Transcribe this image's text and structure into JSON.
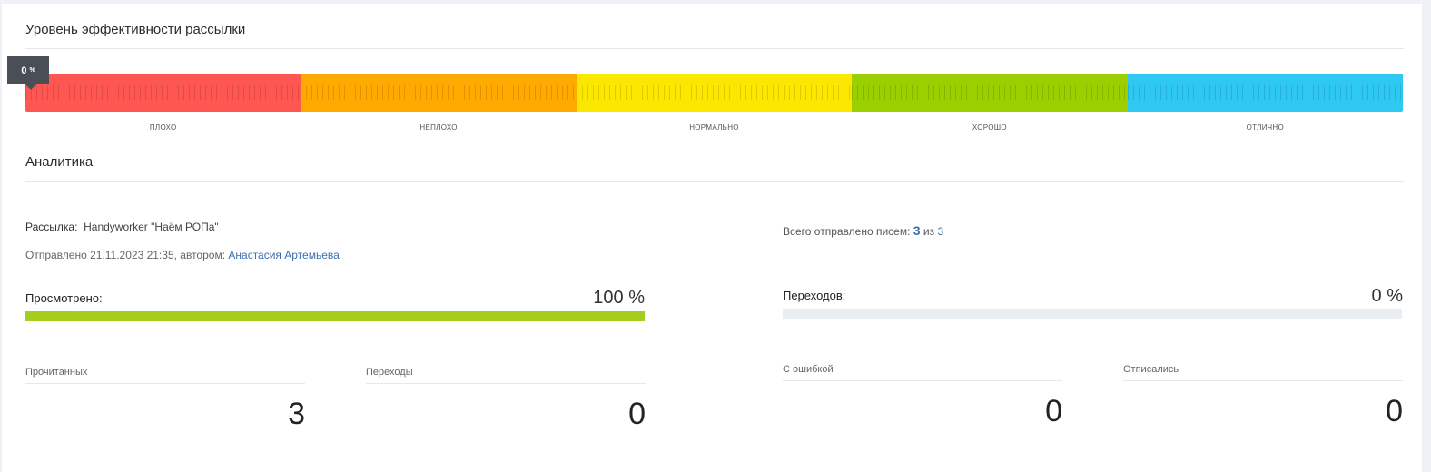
{
  "efficiency": {
    "title": "Уровень эффективности рассылки",
    "marker_value": "0",
    "marker_unit": "%",
    "level_fraction": 0,
    "levels": [
      {
        "label": "ПЛОХО",
        "color": "#fe5752"
      },
      {
        "label": "НЕПЛОХО",
        "color": "#ffaa00"
      },
      {
        "label": "НОРМАЛЬНО",
        "color": "#fbe700"
      },
      {
        "label": "ХОРОШО",
        "color": "#9bcf00"
      },
      {
        "label": "ОТЛИЧНО",
        "color": "#2fc8f3"
      }
    ]
  },
  "analytics": {
    "title": "Аналитика",
    "campaign_label": "Рассылка:",
    "campaign_name": "Handyworker \"Наём РОПа\"",
    "sent_prefix": "Отправлено 21.11.2023 21:35, автором:",
    "author": "Анастасия Артемьева",
    "total_sent_prefix": "Всего отправлено писем:",
    "total_sent": "3",
    "total_sent_of": "из",
    "total_count": "3",
    "viewed": {
      "label": "Просмотрено:",
      "value": "100 %",
      "fraction": 1.0,
      "color": "#a6cd1e"
    },
    "clicks": {
      "label": "Переходов:",
      "value": "0 %",
      "fraction": 0.0,
      "color": "#a6cd1e"
    },
    "stats": [
      {
        "label": "Прочитанных",
        "value": "3"
      },
      {
        "label": "Переходы",
        "value": "0"
      },
      {
        "label": "С ошибкой",
        "value": "0"
      },
      {
        "label": "Отписались",
        "value": "0"
      }
    ]
  }
}
